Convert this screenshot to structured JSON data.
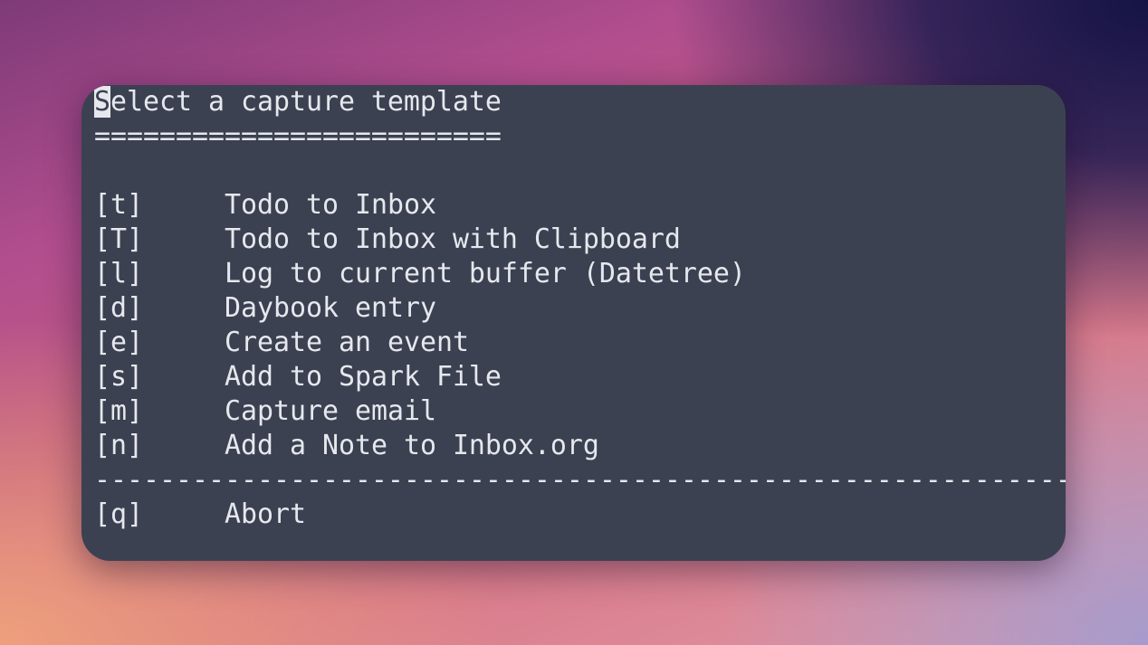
{
  "title": {
    "cursor_char": "S",
    "rest": "elect a capture template"
  },
  "underline": "=========================",
  "templates": [
    {
      "key": "[t]",
      "label": "Todo to Inbox"
    },
    {
      "key": "[T]",
      "label": "Todo to Inbox with Clipboard"
    },
    {
      "key": "[l]",
      "label": "Log to current buffer (Datetree)"
    },
    {
      "key": "[d]",
      "label": "Daybook entry"
    },
    {
      "key": "[e]",
      "label": "Create an event"
    },
    {
      "key": "[s]",
      "label": "Add to Spark File"
    },
    {
      "key": "[m]",
      "label": "Capture email"
    },
    {
      "key": "[n]",
      "label": "Add a Note to Inbox.org"
    }
  ],
  "separator": "------------------------------------------------------------------------------",
  "abort": {
    "key": "[q]",
    "label": "Abort"
  }
}
